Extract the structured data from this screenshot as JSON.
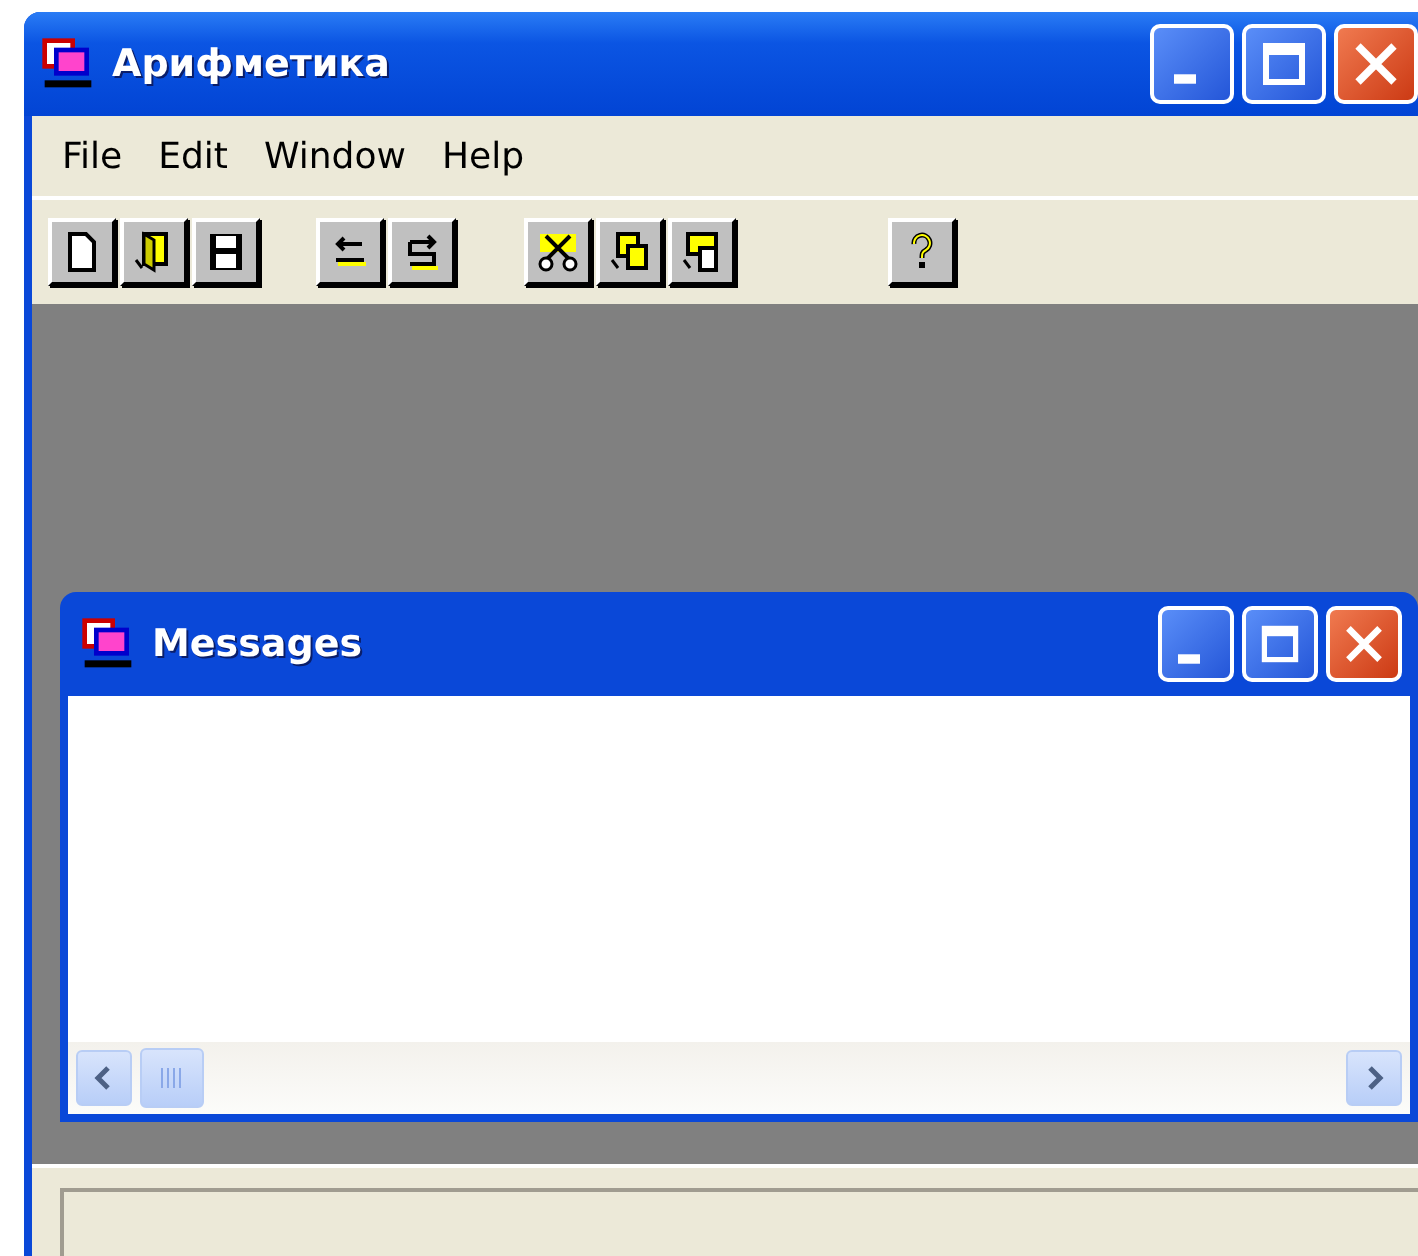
{
  "window": {
    "title": "Арифметика"
  },
  "menu": [
    "File",
    "Edit",
    "Window",
    "Help"
  ],
  "toolbar": [
    [
      {
        "kind": "new"
      },
      {
        "kind": "open"
      },
      {
        "kind": "save"
      }
    ],
    [
      {
        "kind": "undo"
      },
      {
        "kind": "redo"
      }
    ],
    [
      {
        "kind": "cut"
      },
      {
        "kind": "copy"
      },
      {
        "kind": "paste"
      }
    ],
    [
      {
        "kind": "help"
      }
    ]
  ],
  "child_window": {
    "title": "Messages"
  }
}
